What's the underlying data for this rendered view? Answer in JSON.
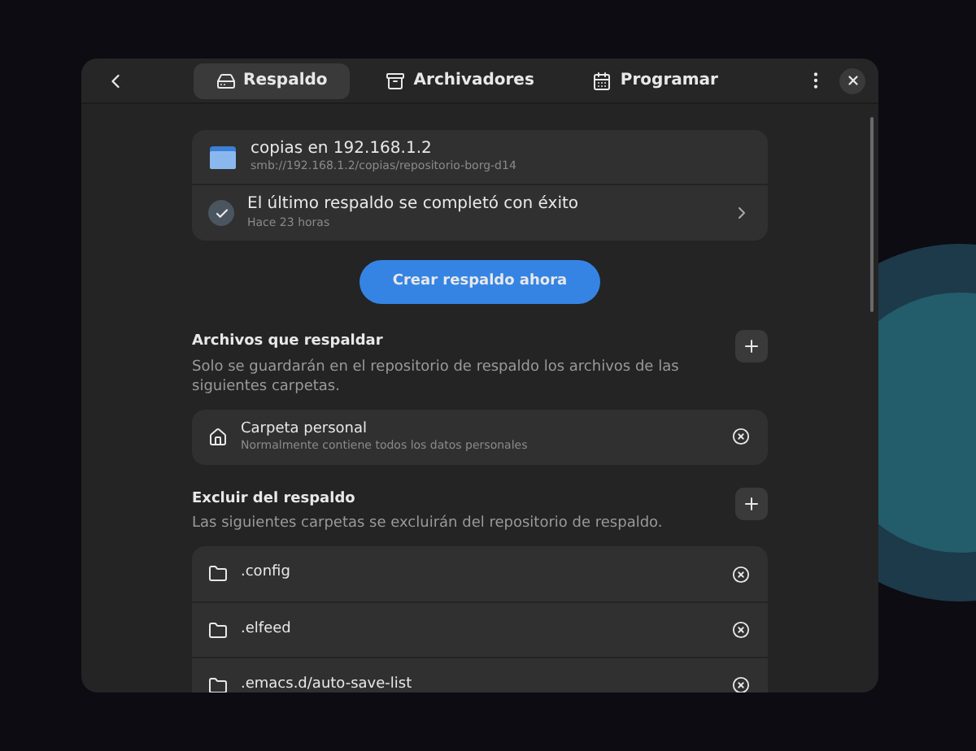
{
  "header": {
    "tabs": [
      {
        "label": "Respaldo",
        "selected": true
      },
      {
        "label": "Archivadores",
        "selected": false
      },
      {
        "label": "Programar",
        "selected": false
      }
    ]
  },
  "repository": {
    "title": "copias en 192.168.1.2",
    "subtitle": "smb://192.168.1.2/copias/repositorio-borg-d14"
  },
  "status": {
    "title": "El último respaldo se completó con éxito",
    "subtitle": "Hace 23 horas"
  },
  "primary_button": "Crear respaldo ahora",
  "sections": [
    {
      "title": "Archivos que respaldar",
      "description": "Solo se guardarán en el repositorio de respaldo los archivos de las siguientes carpetas.",
      "items": [
        {
          "kind": "home",
          "title": "Carpeta personal",
          "subtitle": "Normalmente contiene todos los datos personales"
        }
      ]
    },
    {
      "title": "Excluir del respaldo",
      "description": "Las siguientes carpetas se excluirán del repositorio de respaldo.",
      "items": [
        {
          "kind": "folder",
          "title": ".config"
        },
        {
          "kind": "folder",
          "title": ".elfeed"
        },
        {
          "kind": "folder",
          "title": ".emacs.d/auto-save-list"
        }
      ]
    }
  ]
}
